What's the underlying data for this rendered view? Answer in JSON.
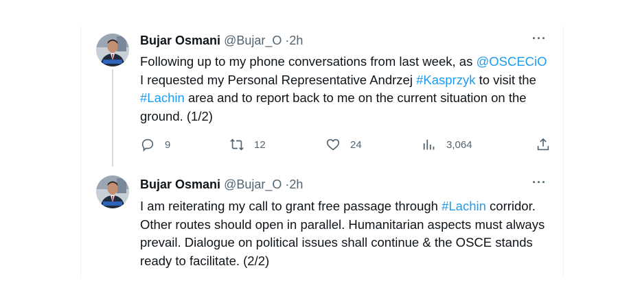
{
  "tweets": [
    {
      "author_name": "Bujar Osmani",
      "handle": "@Bujar_O",
      "separator": "·",
      "time": "2h",
      "more": "···",
      "body_parts": [
        {
          "text": "Following up to my phone conversations from last week, as ",
          "link": false
        },
        {
          "text": "@OSCECiO",
          "link": true
        },
        {
          "text": " I requested my Personal Representative Andrzej ",
          "link": false
        },
        {
          "text": "#Kasprzyk",
          "link": true
        },
        {
          "text": " to visit the ",
          "link": false
        },
        {
          "text": "#Lachin",
          "link": true
        },
        {
          "text": " area and to report back to me on the current situation on the ground. (1/2)",
          "link": false
        }
      ],
      "actions": {
        "reply_count": "9",
        "retweet_count": "12",
        "like_count": "24",
        "views_count": "3,064"
      }
    },
    {
      "author_name": "Bujar Osmani",
      "handle": "@Bujar_O",
      "separator": "·",
      "time": "2h",
      "more": "···",
      "body_parts": [
        {
          "text": "I am reiterating my call to grant free passage through ",
          "link": false
        },
        {
          "text": "#Lachin",
          "link": true
        },
        {
          "text": " corridor. Other routes should open in parallel. Humanitarian aspects must always prevail. Dialogue on political issues shall continue & the OSCE stands ready to facilitate. (2/2)",
          "link": false
        }
      ]
    }
  ],
  "colors": {
    "link": "#1d9bf0",
    "secondary_text": "#536471",
    "primary_text": "#0f1419",
    "thread_line": "#cfd9de"
  },
  "icons": [
    "reply-icon",
    "retweet-icon",
    "like-icon",
    "views-icon",
    "share-icon",
    "more-icon"
  ]
}
